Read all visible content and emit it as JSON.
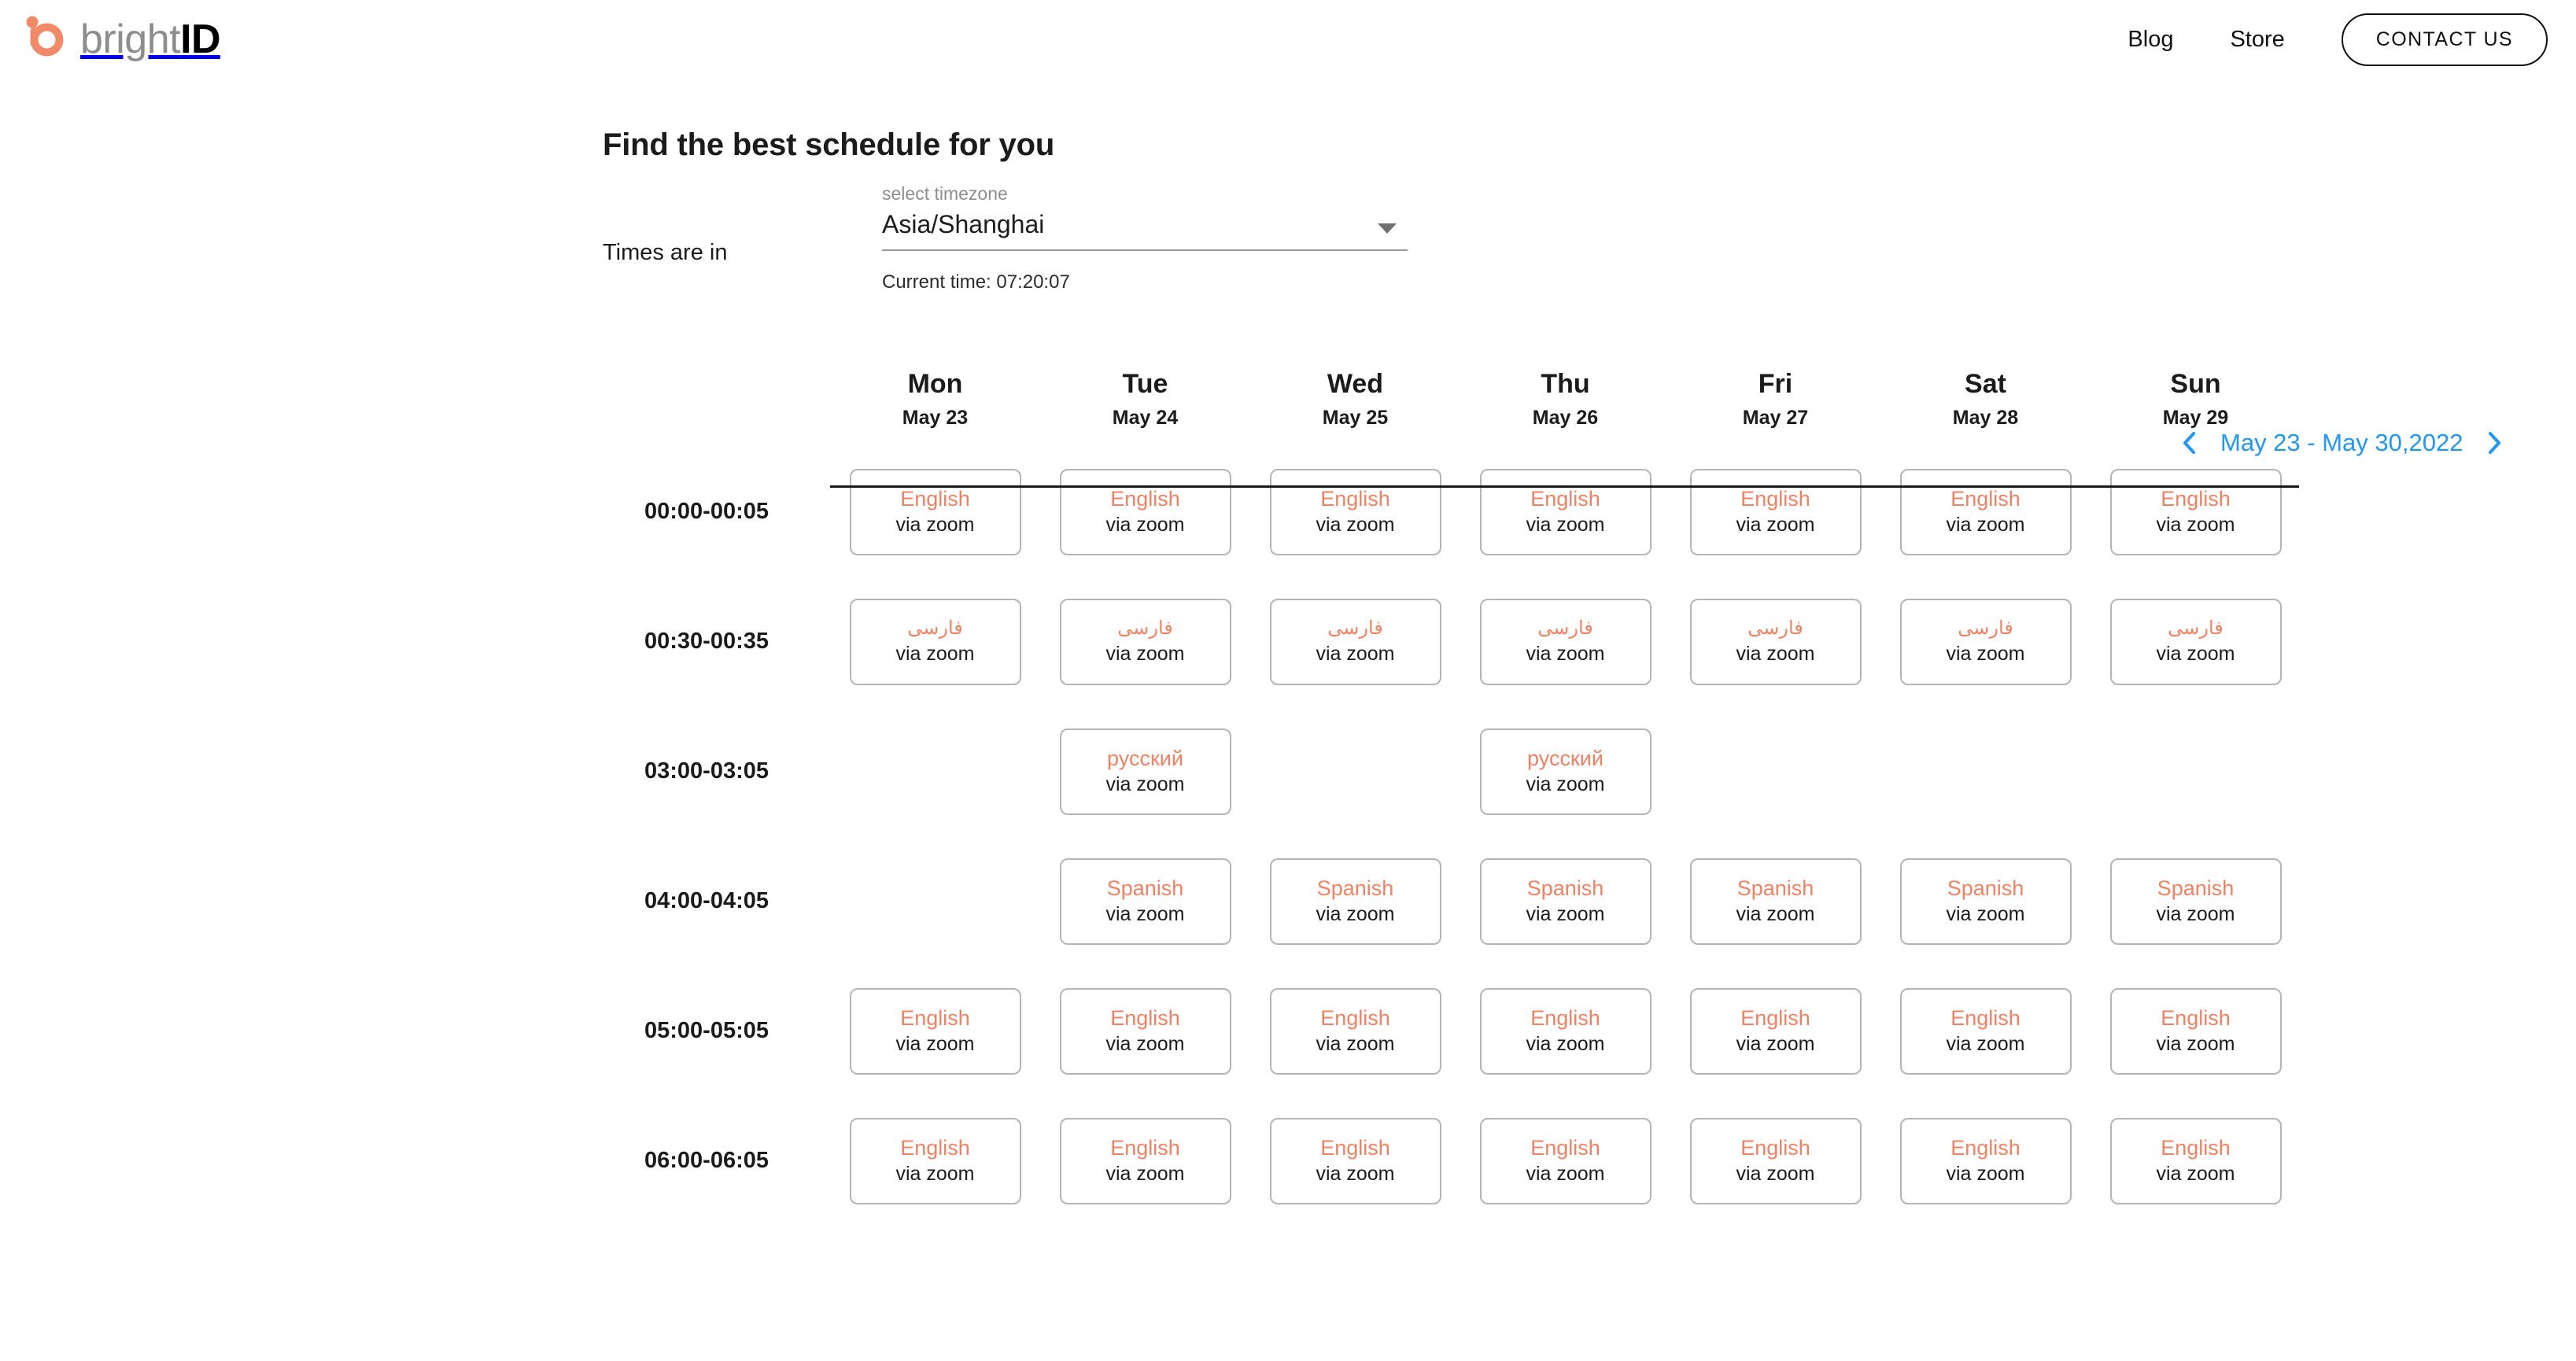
{
  "header": {
    "brand": {
      "bright": "bright",
      "id": "ID",
      "logo_icon": "brightid-logo-icon"
    },
    "nav": [
      {
        "label": "Blog",
        "name": "blog"
      },
      {
        "label": "Store",
        "name": "store"
      }
    ],
    "contact_label": "CONTACT US"
  },
  "page": {
    "title": "Find the best schedule for you"
  },
  "timezone": {
    "prefix_label": "Times are in",
    "field_label": "select timezone",
    "value": "Asia/Shanghai",
    "current_time": "Current time: 07:20:07",
    "caret_icon": "chevron-down-icon"
  },
  "week_nav": {
    "prev_icon": "chevron-left-icon",
    "next_icon": "chevron-right-icon",
    "range": "May 23 - May 30,2022",
    "accent_color": "#2196f3"
  },
  "calendar": {
    "days": [
      {
        "name": "Mon",
        "date": "May 23"
      },
      {
        "name": "Tue",
        "date": "May 24"
      },
      {
        "name": "Wed",
        "date": "May 25"
      },
      {
        "name": "Thu",
        "date": "May 26"
      },
      {
        "name": "Fri",
        "date": "May 27"
      },
      {
        "name": "Sat",
        "date": "May 28"
      },
      {
        "name": "Sun",
        "date": "May 29"
      }
    ],
    "via_label": "via zoom",
    "language_color": "#ee8265",
    "rows": [
      {
        "start": "00:00-",
        "end": "00:05",
        "cells": [
          {
            "lang": "English",
            "rtl": false
          },
          {
            "lang": "English",
            "rtl": false
          },
          {
            "lang": "English",
            "rtl": false
          },
          {
            "lang": "English",
            "rtl": false
          },
          {
            "lang": "English",
            "rtl": false
          },
          {
            "lang": "English",
            "rtl": false
          },
          {
            "lang": "English",
            "rtl": false
          }
        ]
      },
      {
        "start": "00:30-",
        "end": "00:35",
        "cells": [
          {
            "lang": "فارسی",
            "rtl": true
          },
          {
            "lang": "فارسی",
            "rtl": true
          },
          {
            "lang": "فارسی",
            "rtl": true
          },
          {
            "lang": "فارسی",
            "rtl": true
          },
          {
            "lang": "فارسی",
            "rtl": true
          },
          {
            "lang": "فارسی",
            "rtl": true
          },
          {
            "lang": "فارسی",
            "rtl": true
          }
        ]
      },
      {
        "start": "03:00-",
        "end": "03:05",
        "cells": [
          null,
          {
            "lang": "русский",
            "rtl": false
          },
          null,
          {
            "lang": "русский",
            "rtl": false
          },
          null,
          null,
          null
        ]
      },
      {
        "start": "04:00-",
        "end": "04:05",
        "cells": [
          null,
          {
            "lang": "Spanish",
            "rtl": false
          },
          {
            "lang": "Spanish",
            "rtl": false
          },
          {
            "lang": "Spanish",
            "rtl": false
          },
          {
            "lang": "Spanish",
            "rtl": false
          },
          {
            "lang": "Spanish",
            "rtl": false
          },
          {
            "lang": "Spanish",
            "rtl": false
          }
        ]
      },
      {
        "start": "05:00-",
        "end": "05:05",
        "cells": [
          {
            "lang": "English",
            "rtl": false
          },
          {
            "lang": "English",
            "rtl": false
          },
          {
            "lang": "English",
            "rtl": false
          },
          {
            "lang": "English",
            "rtl": false
          },
          {
            "lang": "English",
            "rtl": false
          },
          {
            "lang": "English",
            "rtl": false
          },
          {
            "lang": "English",
            "rtl": false
          }
        ]
      },
      {
        "start": "06:00-",
        "end": "06:05",
        "cells": [
          {
            "lang": "English",
            "rtl": false
          },
          {
            "lang": "English",
            "rtl": false
          },
          {
            "lang": "English",
            "rtl": false
          },
          {
            "lang": "English",
            "rtl": false
          },
          {
            "lang": "English",
            "rtl": false
          },
          {
            "lang": "English",
            "rtl": false
          },
          {
            "lang": "English",
            "rtl": false
          }
        ]
      }
    ]
  }
}
